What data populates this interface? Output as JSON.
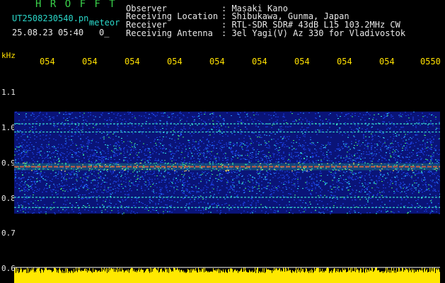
{
  "app": {
    "title": "H R O F F T",
    "filename": "UT2508230540.pn_",
    "tag": "meteor",
    "datetime": "25.08.23 05:40",
    "count": "0_"
  },
  "header": {
    "rows": [
      {
        "label": "Observer",
        "value": ": Masaki Kano"
      },
      {
        "label": "Receiving Location",
        "value": ": Shibukawa, Gunma, Japan"
      },
      {
        "label": "Receiver",
        "value": ": RTL-SDR SDR# 43dB L15 103.2MHz CW"
      },
      {
        "label": "Receiving Antenna",
        "value": ": 3el Yagi(V) Az 330 for Vladivostok"
      }
    ]
  },
  "chart_data": {
    "type": "heatmap",
    "ylabel": "kHz",
    "y_ticks": [
      "1.1",
      "1.0",
      "0.9",
      "0.8",
      "0.7",
      "0.6"
    ],
    "x_ticks": [
      "054",
      "054",
      "054",
      "054",
      "054",
      "054",
      "054",
      "054",
      "054",
      "0550"
    ],
    "ylim": [
      0.6,
      1.12
    ],
    "signal_band_khz": [
      0.77,
      1.02
    ],
    "carrier_khz": 0.885,
    "bright_lines_khz": [
      0.99,
      0.97,
      0.885,
      0.81,
      0.785
    ],
    "colors": {
      "background": "#000000",
      "noise": "#1a2ed0",
      "carrier": "#ff3030",
      "level_bar": "#ffe800",
      "tick_label": "#ffe000"
    }
  }
}
